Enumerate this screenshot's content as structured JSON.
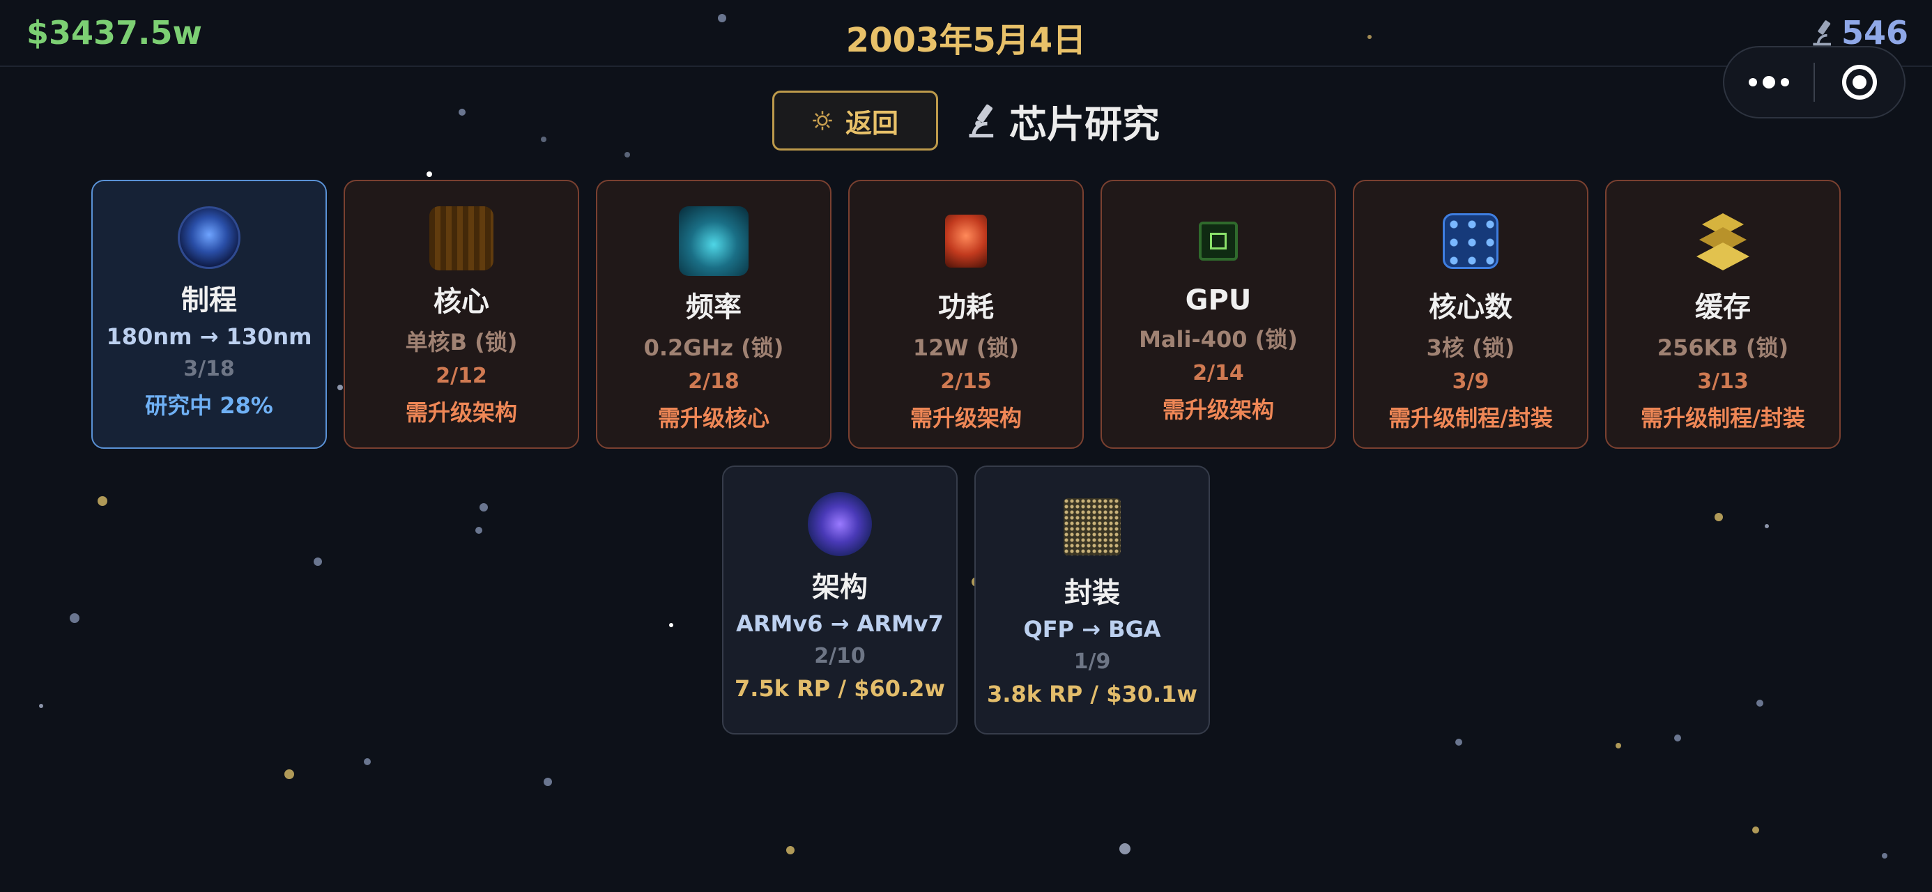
{
  "topbar": {
    "money": "$3437.5w",
    "date": "2003年5月4日",
    "research_points": "546"
  },
  "header": {
    "back_label": "返回",
    "title": "芯片研究"
  },
  "colors": {
    "background": "#0d1119",
    "money": "#7ccf73",
    "date": "#e8c169",
    "rp": "#8fa8e8",
    "locked_border": "#7a4030",
    "locked_status": "#ef8756",
    "active_border": "#5a92d6",
    "active_status": "#6fb0f4",
    "cost": "#e3bd6b"
  },
  "cards": [
    {
      "name": "制程",
      "value": "180nm → 130nm",
      "progress": "3/18",
      "status": "研究中 28%",
      "state": "active",
      "icon": "process-node-icon",
      "research_fraction": 0.28
    },
    {
      "name": "核心",
      "value": "单核B (锁)",
      "progress": "2/12",
      "status": "需升级架构",
      "state": "locked",
      "icon": "core-icon"
    },
    {
      "name": "频率",
      "value": "0.2GHz (锁)",
      "progress": "2/18",
      "status": "需升级核心",
      "state": "locked",
      "icon": "frequency-icon"
    },
    {
      "name": "功耗",
      "value": "12W (锁)",
      "progress": "2/15",
      "status": "需升级架构",
      "state": "locked",
      "icon": "power-icon"
    },
    {
      "name": "GPU",
      "value": "Mali-400 (锁)",
      "progress": "2/14",
      "status": "需升级架构",
      "state": "locked",
      "icon": "gpu-icon"
    },
    {
      "name": "核心数",
      "value": "3核 (锁)",
      "progress": "3/9",
      "status": "需升级制程/封装",
      "state": "locked",
      "icon": "core-count-icon"
    },
    {
      "name": "缓存",
      "value": "256KB (锁)",
      "progress": "3/13",
      "status": "需升级制程/封装",
      "state": "locked",
      "icon": "cache-icon"
    },
    {
      "name": "架构",
      "value": "ARMv6 → ARMv7",
      "progress": "2/10",
      "status": "7.5k RP / $60.2w",
      "state": "avail",
      "icon": "architecture-icon"
    },
    {
      "name": "封装",
      "value": "QFP → BGA",
      "progress": "1/9",
      "status": "3.8k RP / $30.1w",
      "state": "avail",
      "icon": "package-icon"
    }
  ]
}
